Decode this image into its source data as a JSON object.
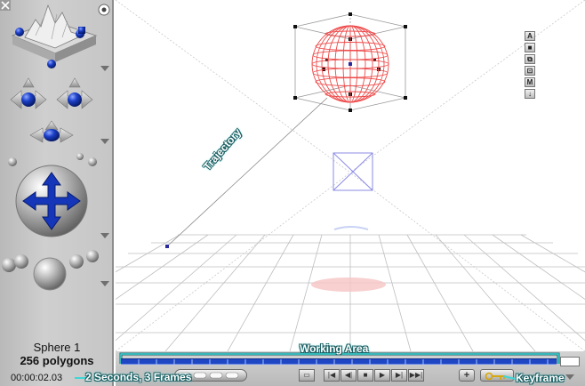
{
  "object": {
    "name": "Sphere 1",
    "polygons": "256 polygons",
    "time": "00:00:02.03"
  },
  "callouts": {
    "working_area": "Working Area",
    "frames": "2 Seconds, 3 Frames",
    "keyframe": "Keyframe",
    "trajectory": "Trajectory"
  },
  "side_toolbar": [
    "A",
    "■",
    "⧉",
    "⊡",
    "M",
    "↓"
  ],
  "transport": {
    "buttons": [
      "|◀",
      "◀|",
      "■",
      "▶",
      "▶|",
      "▶▶|"
    ],
    "add": "+"
  },
  "colors": {
    "accent": "#1f47c4",
    "sphere": "#e53b3b",
    "callout_outline": "#1a5f63"
  }
}
